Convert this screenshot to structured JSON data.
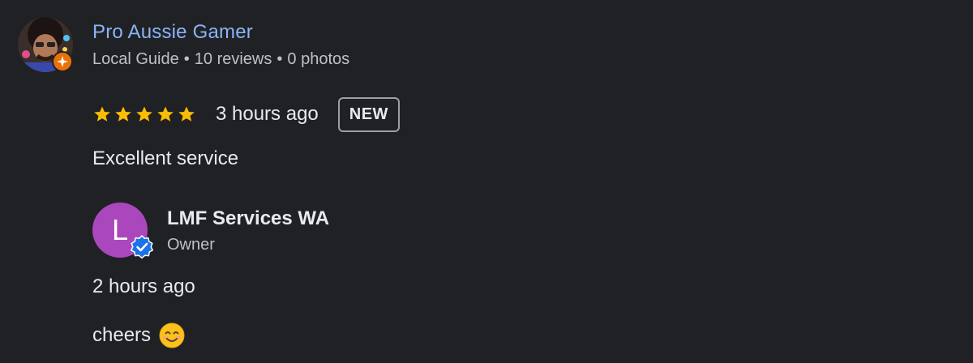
{
  "reviewer": {
    "name": "Pro Aussie Gamer",
    "meta": {
      "badge": "Local Guide",
      "reviews": "10 reviews",
      "photos": "0 photos",
      "separator": "•"
    },
    "avatar_icon": "user-photo-avatar",
    "guide_badge_icon": "local-guide-star-icon"
  },
  "review": {
    "rating": 5,
    "rating_max": 5,
    "time": "3 hours ago",
    "badge": "NEW",
    "text": "Excellent service"
  },
  "owner_response": {
    "initial": "L",
    "name": "LMF Services WA",
    "role": "Owner",
    "time": "2 hours ago",
    "text": "cheers",
    "emoji_icon": "smiling-face-icon",
    "verified_icon": "verified-check-icon"
  },
  "colors": {
    "background": "#202124",
    "reviewer_name": "#8ab4f8",
    "star": "#fbbc04",
    "owner_avatar": "#ab47bc",
    "guide_badge": "#e8710a",
    "verified": "#1a73e8"
  }
}
